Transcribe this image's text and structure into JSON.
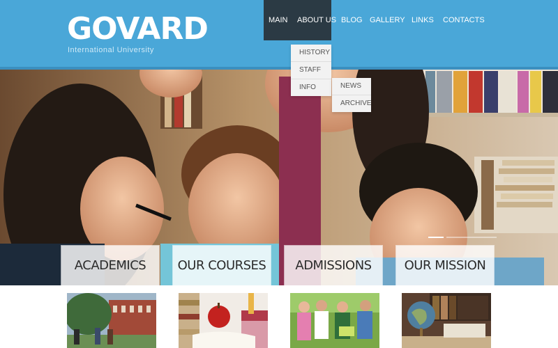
{
  "brand": {
    "logo": "GOVARD",
    "tagline": "International University"
  },
  "nav": {
    "items": [
      {
        "label": "MAIN",
        "active": true
      },
      {
        "label": "ABOUT US"
      },
      {
        "label": "BLOG"
      },
      {
        "label": "GALLERY"
      },
      {
        "label": "LINKS"
      },
      {
        "label": "CONTACTS"
      }
    ],
    "about_submenu": [
      "HISTORY",
      "STAFF",
      "INFO"
    ],
    "info_submenu": [
      "NEWS",
      "ARCHIVE"
    ]
  },
  "features": [
    {
      "title": "ACADEMICS",
      "image": "campus-photo"
    },
    {
      "title": "OUR COURSES",
      "image": "books-apple-photo"
    },
    {
      "title": "ADMISSIONS",
      "image": "students-grass-photo"
    },
    {
      "title": "OUR MISSION",
      "image": "globe-library-photo"
    }
  ],
  "colors": {
    "header_bg": "#4aa7d8",
    "nav_active_bg": "#2b3a44",
    "dropdown_bg": "#f2f2f2"
  }
}
